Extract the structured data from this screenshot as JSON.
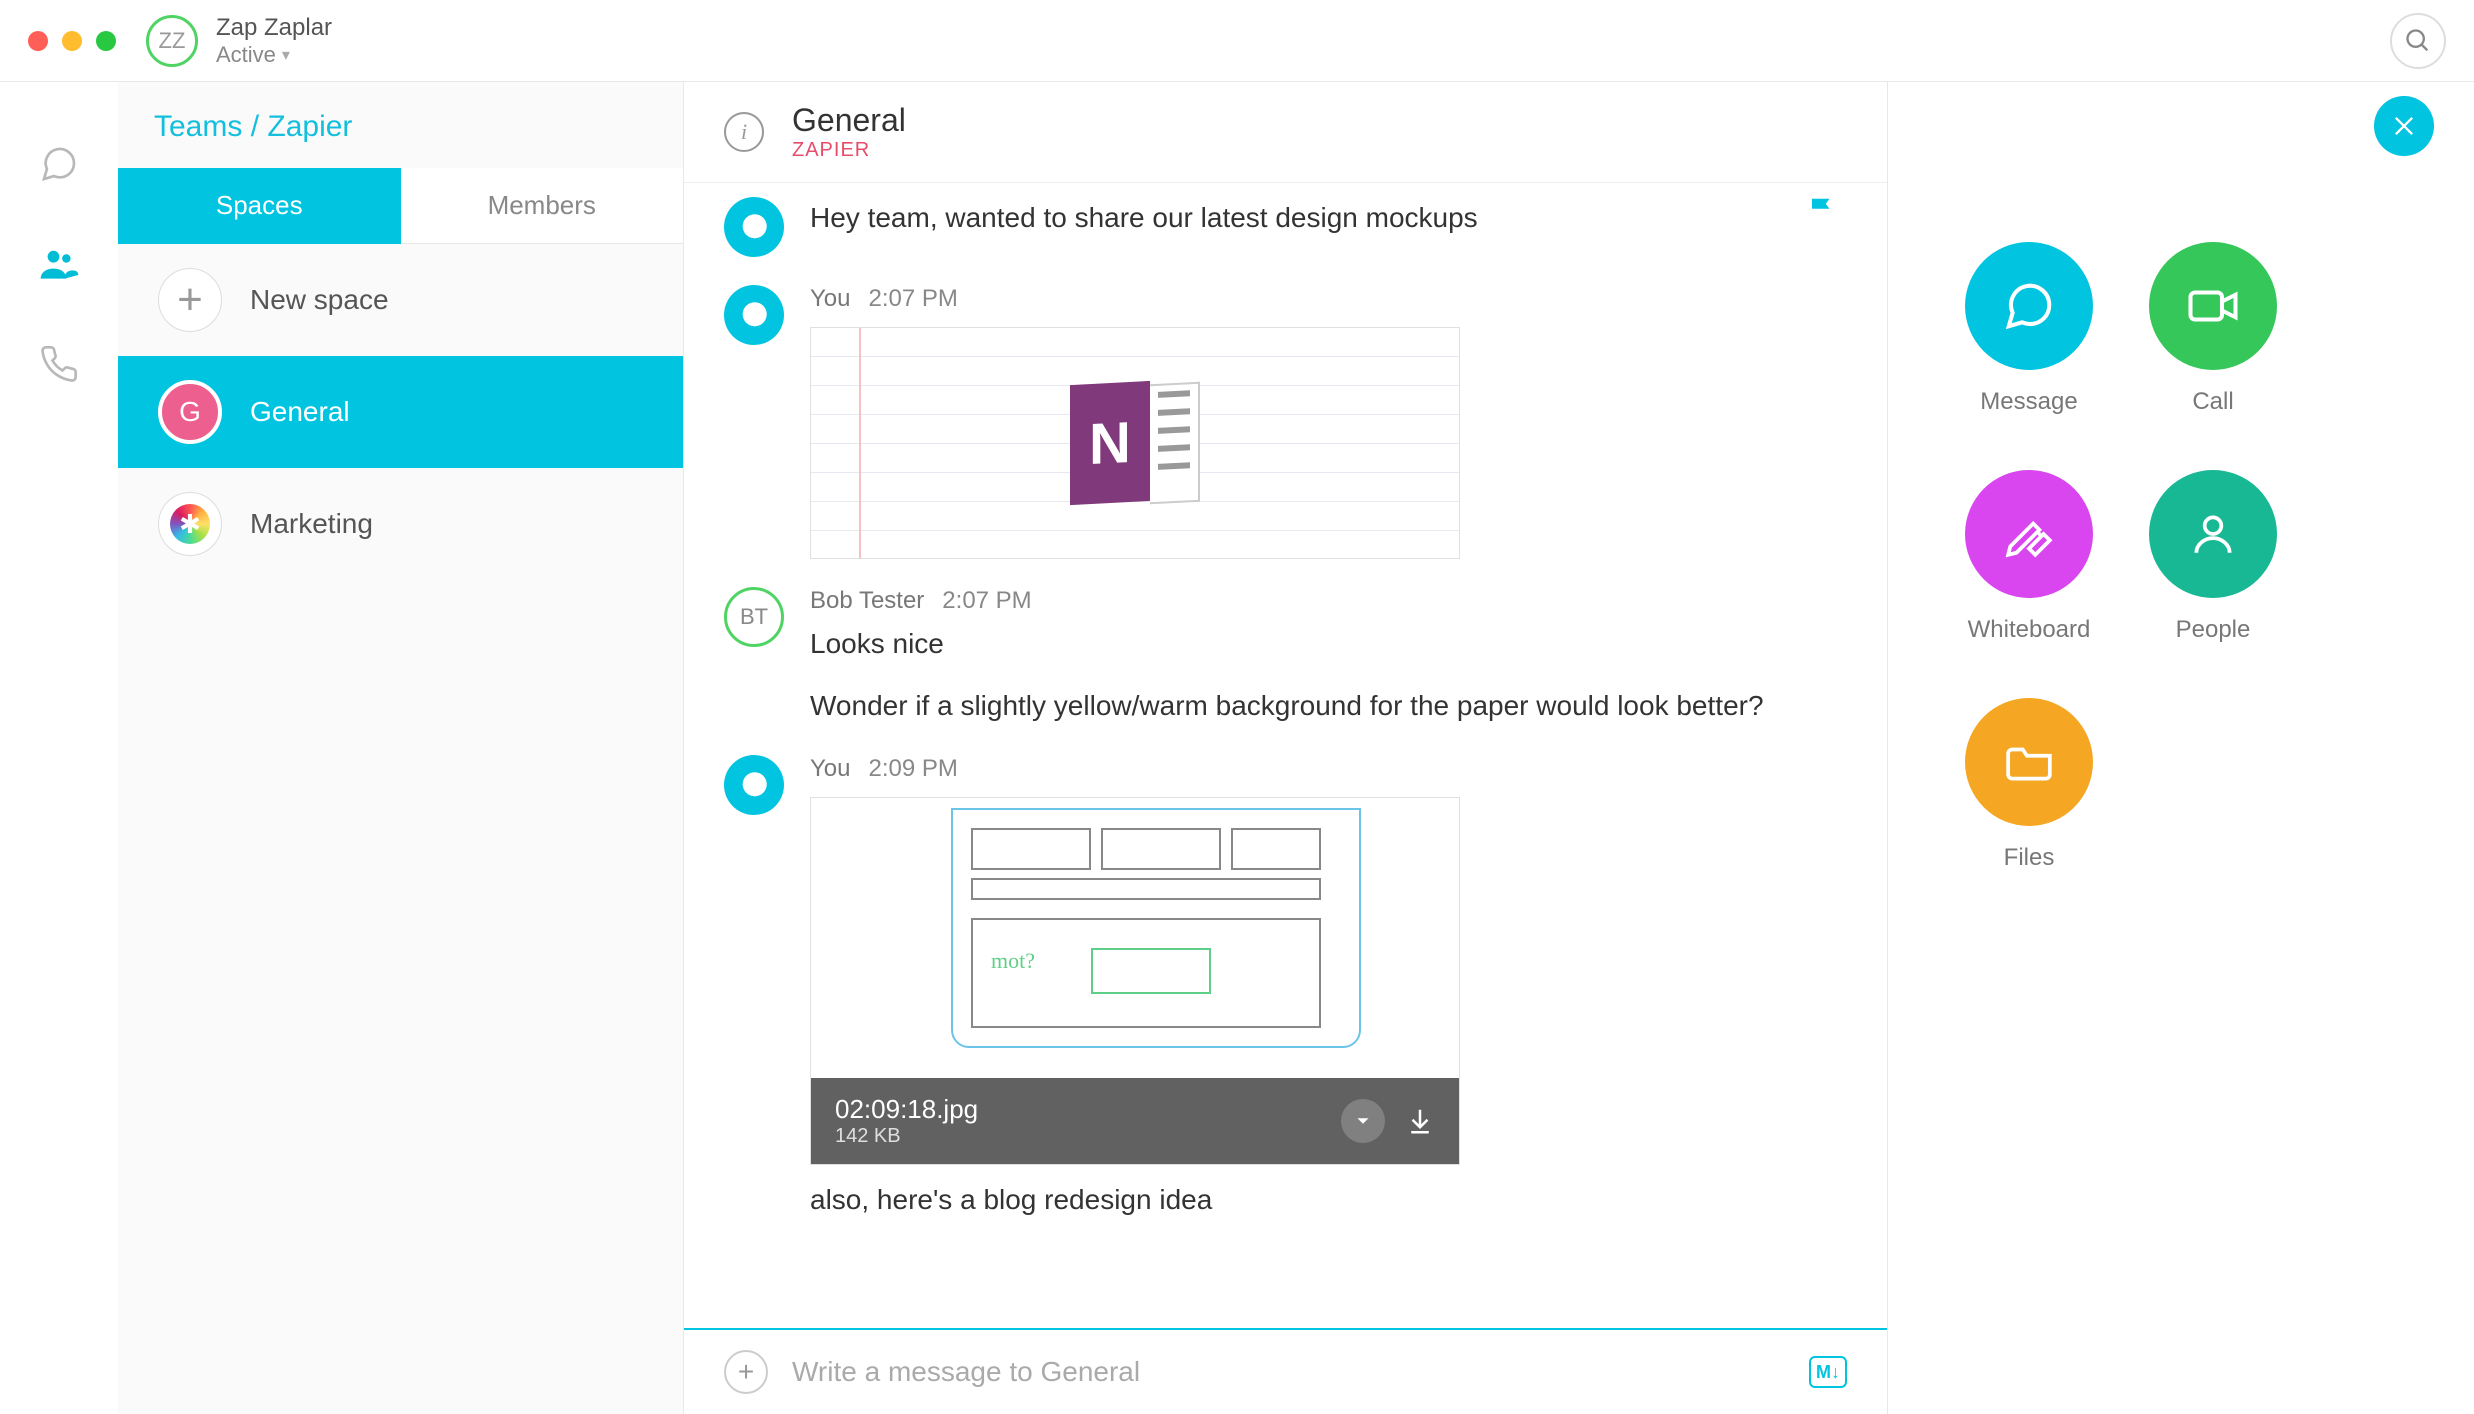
{
  "titlebar": {
    "avatar_initials": "ZZ",
    "user_name": "Zap Zaplar",
    "status": "Active"
  },
  "sidebar": {
    "breadcrumb_teams": "Teams",
    "breadcrumb_sep": " / ",
    "breadcrumb_team": "Zapier",
    "tabs": {
      "spaces": "Spaces",
      "members": "Members"
    },
    "new_space": "New space",
    "items": [
      {
        "initial": "G",
        "label": "General"
      },
      {
        "label": "Marketing"
      }
    ]
  },
  "conversation": {
    "title": "General",
    "subtitle": "ZAPIER",
    "compose_placeholder": "Write a message to General",
    "messages": [
      {
        "sender": "",
        "time": "",
        "text": "Hey team, wanted to share our latest design mockups",
        "flag": true,
        "avatar": "you"
      },
      {
        "sender": "You",
        "time": "2:07 PM",
        "avatar": "you",
        "attachment": "notepad"
      },
      {
        "sender": "Bob Tester",
        "time": "2:07 PM",
        "avatar": "bob",
        "avatar_initials": "BT",
        "text": "Looks nice",
        "text2": "Wonder if a slightly yellow/warm background for the paper would look better?"
      },
      {
        "sender": "You",
        "time": "2:09 PM",
        "avatar": "you",
        "attachment": "sketch",
        "file_name": "02:09:18.jpg",
        "file_size": "142 KB",
        "text_after": "also, here's a blog redesign idea"
      }
    ]
  },
  "actions": {
    "message": "Message",
    "call": "Call",
    "whiteboard": "Whiteboard",
    "people": "People",
    "files": "Files"
  }
}
